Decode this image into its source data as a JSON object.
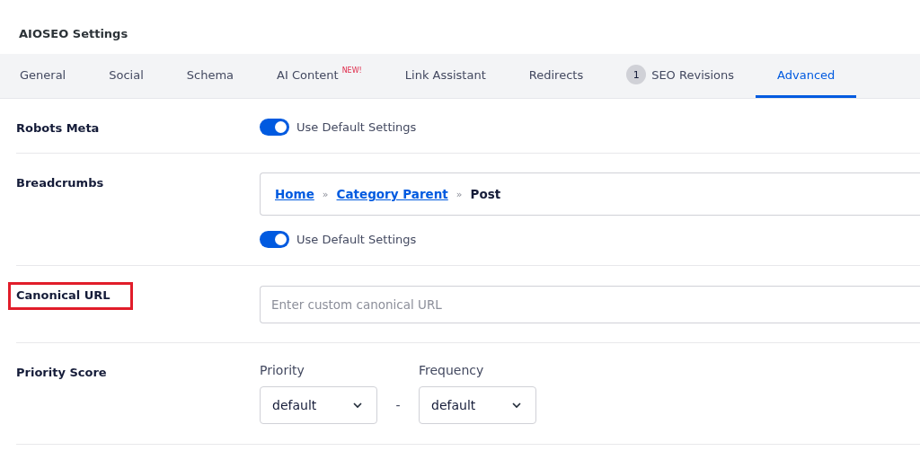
{
  "page_title": "AIOSEO Settings",
  "tabs": [
    {
      "label": "General",
      "selected": false
    },
    {
      "label": "Social",
      "selected": false
    },
    {
      "label": "Schema",
      "selected": false
    },
    {
      "label": "AI Content",
      "badge": "NEW!",
      "selected": false
    },
    {
      "label": "Link Assistant",
      "selected": false
    },
    {
      "label": "Redirects",
      "selected": false
    },
    {
      "label": "SEO Revisions",
      "count": "1",
      "selected": false
    },
    {
      "label": "Advanced",
      "selected": true
    }
  ],
  "settings": [
    {
      "kind": "toggle",
      "label": "Robots Meta",
      "highlighted": false,
      "toggle": {
        "on": true,
        "label": "Use Default Settings"
      }
    },
    {
      "kind": "breadcrumbs",
      "label": "Breadcrumbs",
      "highlighted": false,
      "crumbs": [
        {
          "text": "Home",
          "link": true
        },
        {
          "text": "»",
          "link": false
        },
        {
          "text": "Category Parent",
          "link": true
        },
        {
          "text": "»",
          "link": false
        },
        {
          "text": "Post",
          "link": false
        }
      ],
      "toggle": {
        "on": true,
        "label": "Use Default Settings"
      }
    },
    {
      "kind": "text-input",
      "label": "Canonical URL",
      "highlighted": true,
      "placeholder": "Enter custom canonical URL"
    },
    {
      "kind": "selects",
      "label": "Priority Score",
      "highlighted": false,
      "selects": [
        {
          "label": "Priority",
          "value": "default"
        },
        {
          "label": "Frequency",
          "value": "default"
        }
      ],
      "separator": "-"
    }
  ]
}
